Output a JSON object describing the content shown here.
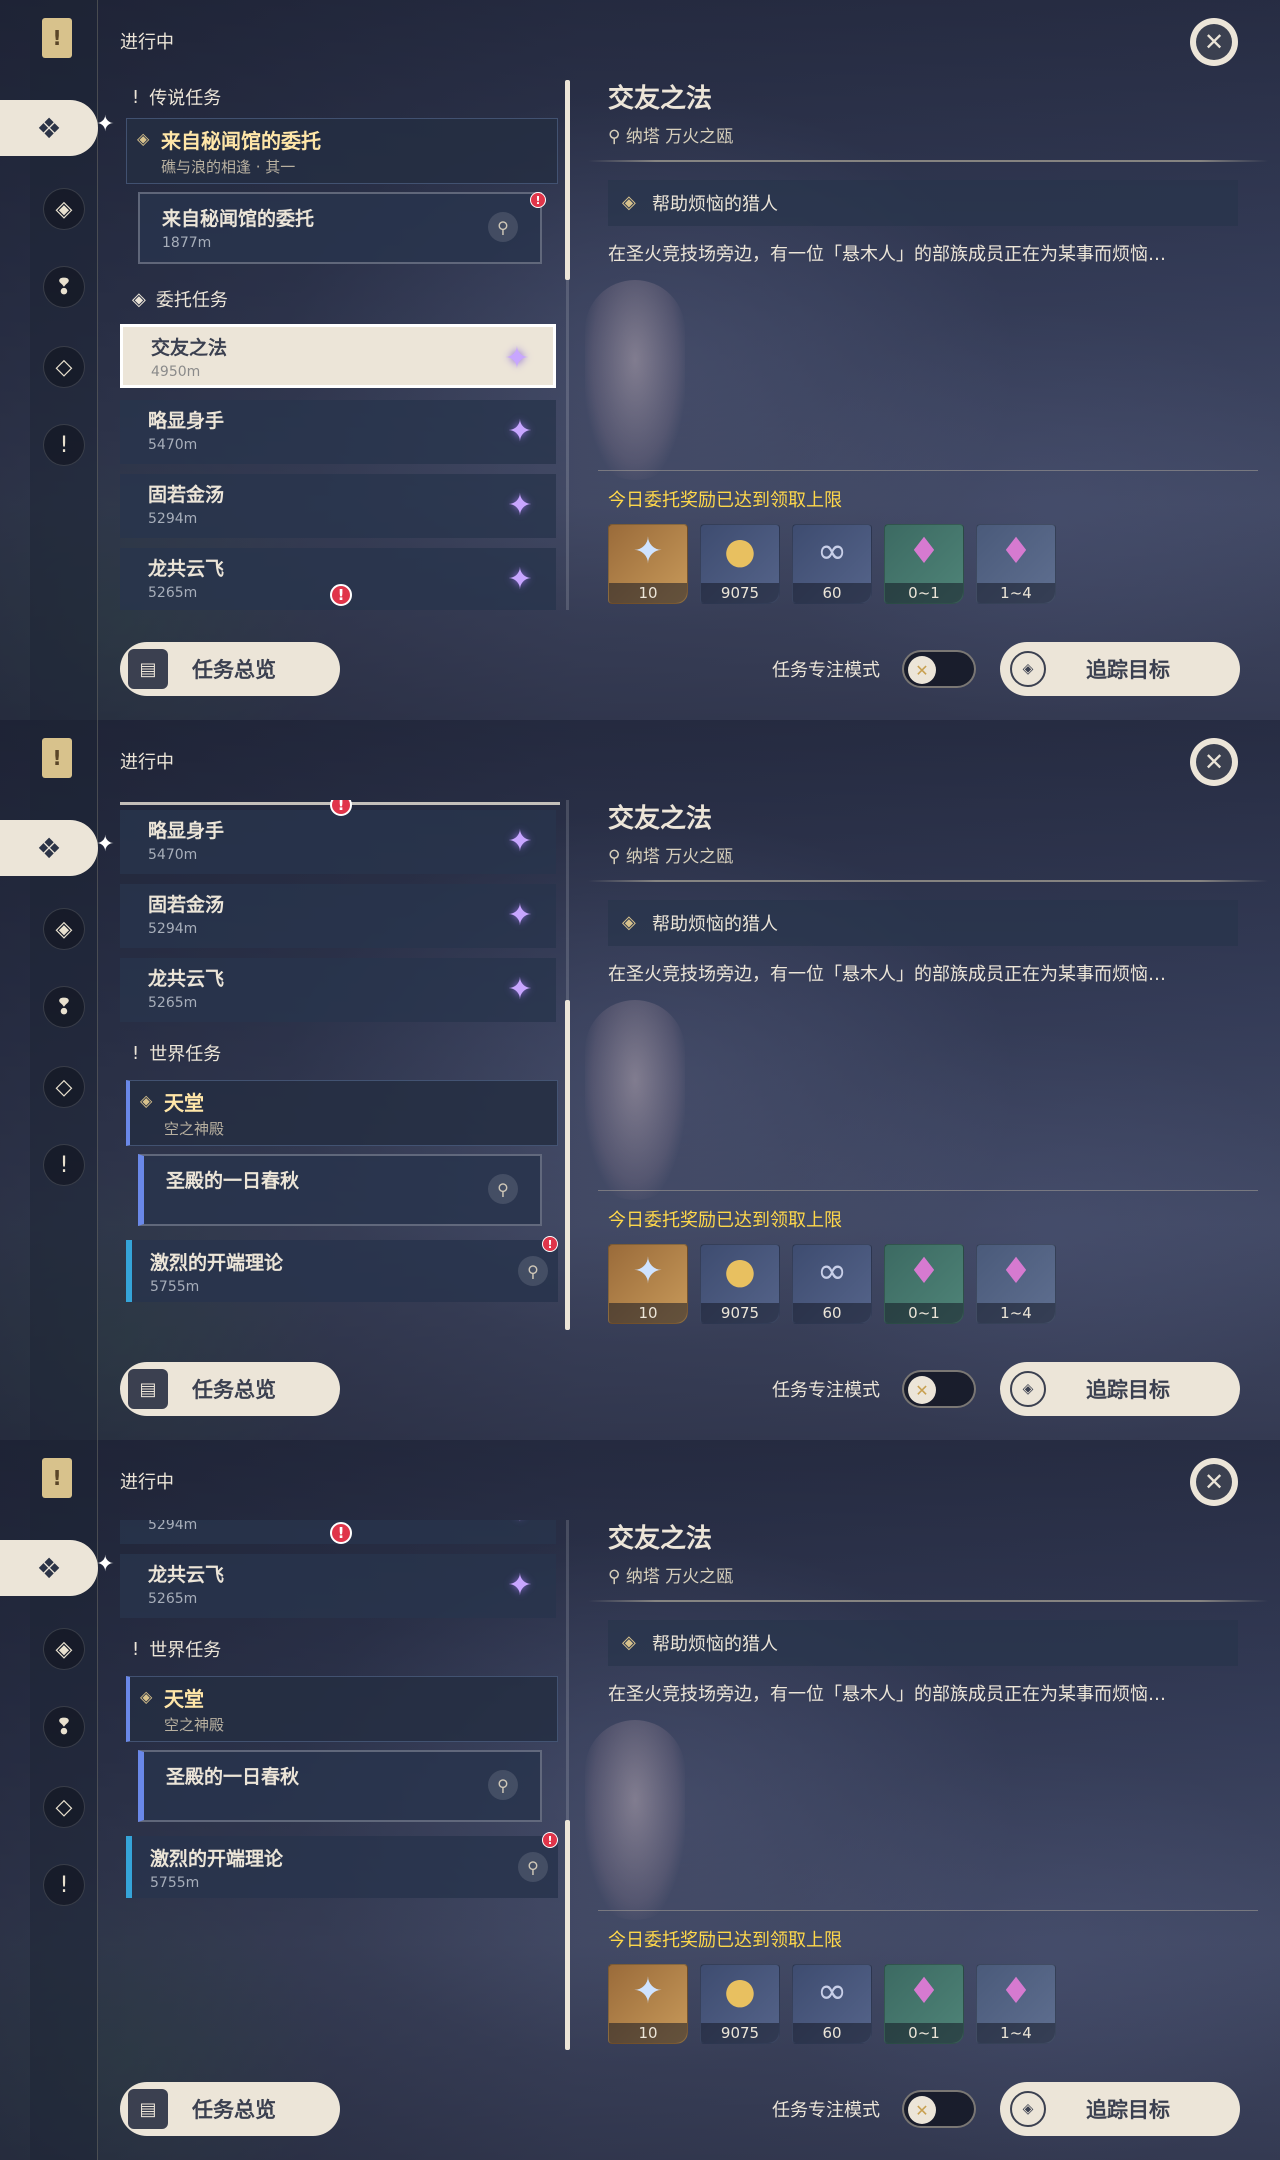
{
  "common": {
    "status": "进行中",
    "close_label": "✕",
    "title": "交友之法",
    "location_city": "纳塔",
    "location_place": "万火之瓯",
    "objective": "帮助烦恼的猎人",
    "description": "在圣火竞技场旁边，有一位「悬木人」的部族成员正在为某事而烦恼…",
    "reward_notice": "今日委托奖励已达到领取上限",
    "rewards": [
      {
        "icon": "primogem-icon",
        "count": "10"
      },
      {
        "icon": "mora-icon",
        "count": "9075"
      },
      {
        "icon": "companionship-exp-icon",
        "count": "60"
      },
      {
        "icon": "crystal-icon",
        "count": "0~1"
      },
      {
        "icon": "crystal-cluster-icon",
        "count": "1~4"
      }
    ],
    "overview_button": "任务总览",
    "focus_mode_label": "任务专注模式",
    "track_button": "追踪目标"
  },
  "sections": {
    "legend": "传说任务",
    "commission": "委托任务",
    "world": "世界任务"
  },
  "quests": {
    "legend_group": {
      "title": "来自秘闻馆的委托",
      "subtitle": "礁与浪的相逢 · 其一"
    },
    "legend_sub": {
      "title": "来自秘闻馆的委托",
      "distance": "1877m"
    },
    "commissions": [
      {
        "title": "交友之法",
        "distance": "4950m"
      },
      {
        "title": "略显身手",
        "distance": "5470m"
      },
      {
        "title": "固若金汤",
        "distance": "5294m"
      },
      {
        "title": "龙共云飞",
        "distance": "5265m"
      }
    ],
    "world_group": {
      "title": "天堂",
      "subtitle": "空之神殿"
    },
    "world_sub": {
      "title": "圣殿的一日春秋"
    },
    "world_other": {
      "title": "激烈的开端理论",
      "distance": "5755m"
    }
  },
  "colors": {
    "accent_gold": "#ffd84a",
    "panel_cream": "#ece5d8",
    "alert_red": "#e0354a"
  }
}
